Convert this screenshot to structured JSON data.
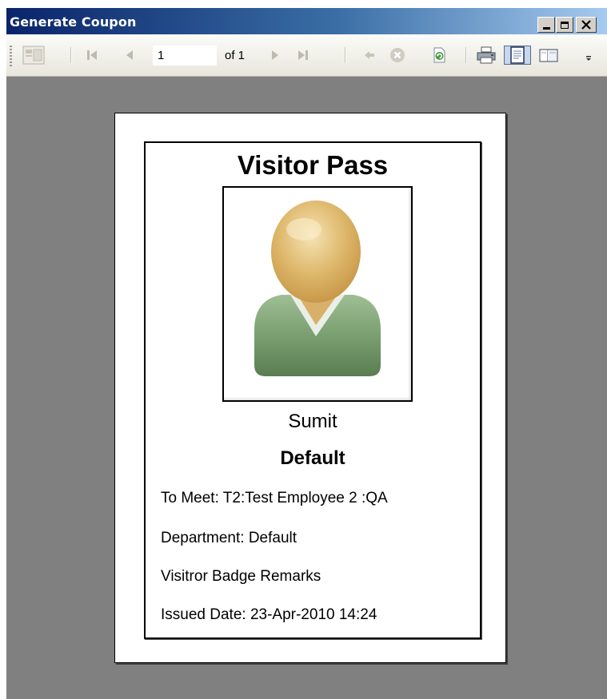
{
  "window": {
    "title": "Generate Coupon"
  },
  "toolbar": {
    "page_value": "1",
    "of_label": "of 1"
  },
  "badge": {
    "title": "Visitor Pass",
    "visitor_name": "Sumit",
    "company": "Default",
    "to_meet": "To Meet: T2:Test Employee 2 :QA",
    "department": "Department: Default",
    "remarks": "Visitror Badge  Remarks",
    "issued_date": "Issued Date: 23-Apr-2010 14:24"
  }
}
